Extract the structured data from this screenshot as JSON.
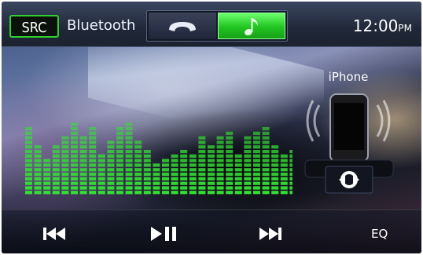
{
  "topbar": {
    "source_button": "SRC",
    "source_name": "Bluetooth",
    "tabs": [
      {
        "icon": "phone-handset-icon",
        "active": false
      },
      {
        "icon": "music-note-icon",
        "active": true
      }
    ],
    "clock": {
      "time": "12:00",
      "ampm": "PM"
    }
  },
  "device": {
    "name": "iPhone",
    "connect_icon": "sync-icon"
  },
  "controls": {
    "prev_icon": "skip-previous-icon",
    "play_pause_icon": "play-pause-icon",
    "next_icon": "skip-next-icon",
    "eq_label": "EQ"
  },
  "equalizer": {
    "bar_levels": [
      15,
      11,
      8,
      11,
      13,
      16,
      13,
      15,
      9,
      12,
      15,
      16,
      12,
      10,
      7,
      8,
      9,
      10,
      9,
      13,
      11,
      13,
      14,
      9,
      13,
      14,
      15,
      11,
      9,
      10,
      7
    ],
    "bar_color": "#35e035",
    "max_segments": 16
  }
}
